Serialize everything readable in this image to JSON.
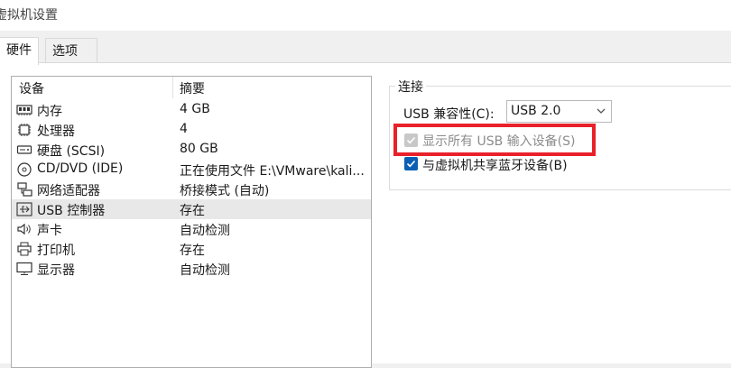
{
  "window": {
    "title": "虚拟机设置"
  },
  "tabs": [
    {
      "label": "硬件",
      "active": true
    },
    {
      "label": "选项",
      "active": false
    }
  ],
  "device_list": {
    "columns": [
      "设备",
      "摘要"
    ],
    "rows": [
      {
        "name": "内存",
        "summary": "4 GB",
        "icon": "memory-icon"
      },
      {
        "name": "处理器",
        "summary": "4",
        "icon": "processor-icon"
      },
      {
        "name": "硬盘 (SCSI)",
        "summary": "80 GB",
        "icon": "hard-disk-icon"
      },
      {
        "name": "CD/DVD (IDE)",
        "summary": "正在使用文件 E:\\VMware\\kali...",
        "icon": "cd-dvd-icon"
      },
      {
        "name": "网络适配器",
        "summary": "桥接模式 (自动)",
        "icon": "network-adapter-icon"
      },
      {
        "name": "USB 控制器",
        "summary": "存在",
        "icon": "usb-icon",
        "selected": true
      },
      {
        "name": "声卡",
        "summary": "自动检测",
        "icon": "sound-card-icon"
      },
      {
        "name": "打印机",
        "summary": "存在",
        "icon": "printer-icon"
      },
      {
        "name": "显示器",
        "summary": "自动检测",
        "icon": "display-icon"
      }
    ]
  },
  "connection": {
    "group_label": "连接",
    "compat_label": "USB 兼容性(C):",
    "compat_value": "USB 2.0",
    "show_all_usb": {
      "label": "显示所有 USB 输入设备(S)",
      "checked": true,
      "enabled": false
    },
    "share_bluetooth": {
      "label": "与虚拟机共享蓝牙设备(B)",
      "checked": true,
      "enabled": true
    }
  },
  "colors": {
    "highlight": "#e8212a",
    "checkbox_checked": "#0a5fb4",
    "selection": "#e8e8e8"
  }
}
